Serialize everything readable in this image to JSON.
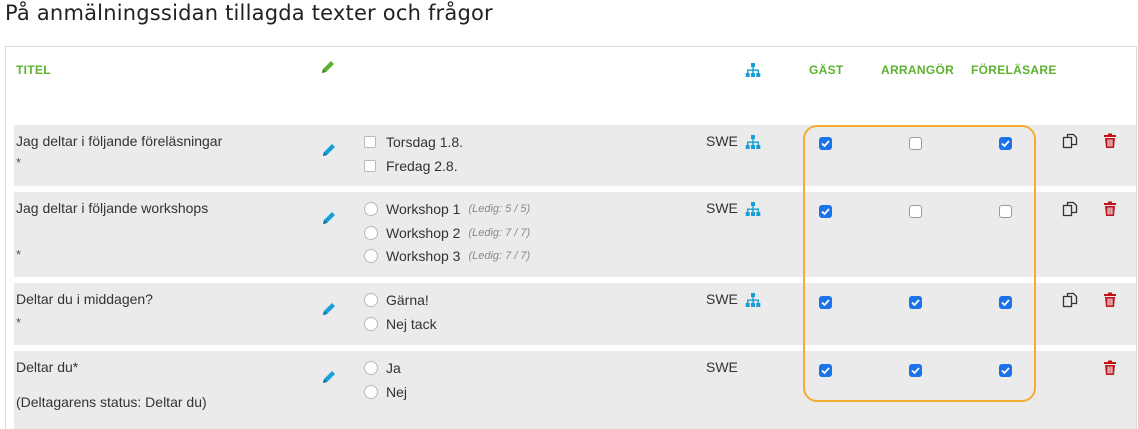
{
  "page": {
    "title": "På anmälningssidan tillagda texter och frågor"
  },
  "table": {
    "headers": {
      "title": "TITEL",
      "guest": "GÄST",
      "organizer": "ARRANGÖR",
      "lecturer": "FÖRELÄSARE"
    },
    "rows": [
      {
        "title": "Jag deltar i följande föreläsningar",
        "required_mark": "*",
        "options": [
          {
            "label": "Torsdag 1.8.",
            "note": ""
          },
          {
            "label": "Fredag 2.8.",
            "note": ""
          }
        ],
        "language": "SWE",
        "guest": true,
        "organizer": false,
        "lecturer": true
      },
      {
        "title": "Jag deltar i följande workshops",
        "required_mark": "*",
        "options": [
          {
            "label": "Workshop 1",
            "note": "(Ledig: 5 / 5)"
          },
          {
            "label": "Workshop 2",
            "note": "(Ledig: 7 / 7)"
          },
          {
            "label": "Workshop 3",
            "note": "(Ledig: 7 / 7)"
          }
        ],
        "language": "SWE",
        "guest": true,
        "organizer": false,
        "lecturer": false
      },
      {
        "title": "Deltar du i middagen?",
        "required_mark": "*",
        "options": [
          {
            "label": "Gärna!",
            "note": ""
          },
          {
            "label": "Nej tack",
            "note": ""
          }
        ],
        "language": "SWE",
        "guest": true,
        "organizer": true,
        "lecturer": true
      },
      {
        "title": "Deltar du*",
        "status": "(Deltagarens status: Deltar du)",
        "options": [
          {
            "label": "Ja",
            "note": ""
          },
          {
            "label": "Nej",
            "note": ""
          }
        ],
        "language": "SWE",
        "guest": true,
        "organizer": true,
        "lecturer": true
      }
    ]
  },
  "colors": {
    "header_green": "#5db130",
    "accent_blue": "#1a73e8",
    "highlight_orange": "#f5ad2f",
    "delete_red": "#c0121a",
    "tree_teal": "#1a9ed8"
  },
  "icons": [
    "pencil-icon",
    "hierarchy-icon",
    "copy-icon",
    "trash-icon"
  ]
}
